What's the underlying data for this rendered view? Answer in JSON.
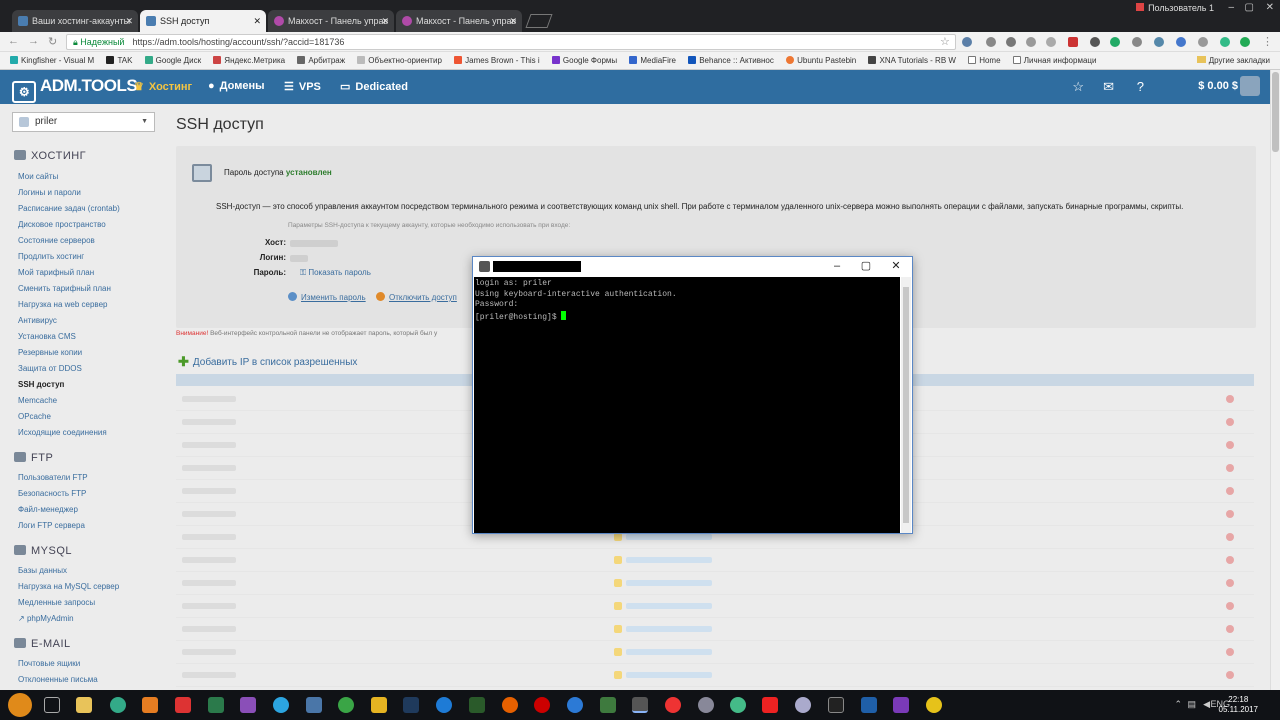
{
  "browser": {
    "tabs": [
      {
        "label": "Ваши хостинг-аккаунты",
        "active": false
      },
      {
        "label": "SSH доступ",
        "active": true
      },
      {
        "label": "Макхост - Панель управ",
        "active": false
      },
      {
        "label": "Макхост - Панель управ",
        "active": false
      }
    ],
    "user": "Пользователь 1",
    "secure_label": "Надежный",
    "url": "https://adm.tools/hosting/account/ssh/?accid=181736",
    "bookmarks": [
      "Kingfisher - Visual M",
      "TAK",
      "Google Диск",
      "Яндекс.Метрика",
      "Арбитраж",
      "Объектно-ориентир",
      "James Brown - This i",
      "Google Формы",
      "MediaFire",
      "Behance :: Активнос",
      "Ubuntu Pastebin",
      "XNA Tutorials - RB W",
      "Home",
      "Личная информаци"
    ],
    "other_bookmarks": "Другие закладки"
  },
  "app": {
    "logo": "ADM.TOOLS",
    "menu": [
      "Хостинг",
      "Домены",
      "VPS",
      "Dedicated"
    ],
    "balance": "$ 0.00 $"
  },
  "sidebar": {
    "account": "priler",
    "sections": [
      {
        "title": "ХОСТИНГ",
        "items": [
          "Мои сайты",
          "Логины и пароли",
          "Расписание задач (crontab)",
          "Дисковое пространство",
          "Состояние серверов",
          "Продлить хостинг",
          "Мой тарифный план",
          "Сменить тарифный план",
          "Нагрузка на web сервер",
          "Антивирус",
          "Установка CMS",
          "Резервные копии",
          "Защита от DDOS",
          "SSH доступ",
          "Memcache",
          "OPcache",
          "Исходящие соединения"
        ]
      },
      {
        "title": "FTP",
        "items": [
          "Пользователи FTP",
          "Безопасность FTP",
          "Файл-менеджер",
          "Логи FTP сервера"
        ]
      },
      {
        "title": "MYSQL",
        "items": [
          "Базы данных",
          "Нагрузка на MySQL сервер",
          "Медленные запросы",
          "phpMyAdmin"
        ]
      },
      {
        "title": "E-MAIL",
        "items": [
          "Почтовые ящики",
          "Отклоненные письма"
        ]
      }
    ],
    "active_item": "SSH доступ"
  },
  "main": {
    "title": "SSH доступ",
    "password_status_prefix": "Пароль доступа",
    "password_status": "установлен",
    "description": "SSH-доступ — это способ управления аккаунтом посредством терминального режима и соответствующих команд unix shell. При работе с терминалом удаленного unix-сервера можно выполнять операции с файлами, запускать бинарные программы, скрипты.",
    "params_note": "Параметры SSH-доступа к текущему аккаунту, которые необходимо использовать при входе:",
    "host_label": "Хост:",
    "login_label": "Логин:",
    "password_label": "Пароль:",
    "show_password": "Показать пароль",
    "change_password": "Изменить пароль",
    "disable_access": "Отключить доступ",
    "warning_prefix": "Внимание!",
    "warning_text": "Веб-интерфейс контрольной панели не отображает пароль, который был у",
    "add_ip": "Добавить IP в список разрешенных"
  },
  "putty": {
    "terminal_lines": [
      "login as: priler",
      "Using keyboard-interactive authentication.",
      "Password:"
    ],
    "prompt": "[priler@hosting]$ "
  },
  "taskbar": {
    "lang": "ENG",
    "time": "22:18",
    "date": "05.11.2017"
  }
}
